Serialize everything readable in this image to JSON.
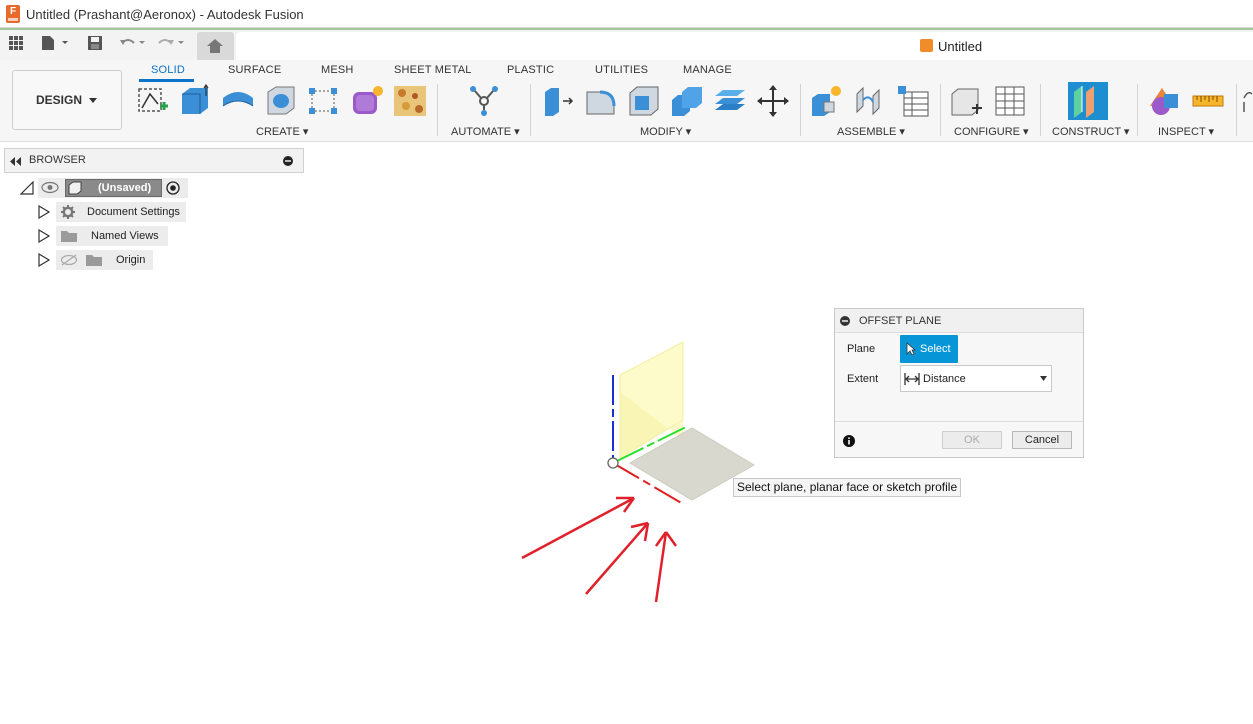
{
  "window": {
    "title": "Untitled (Prashant@Aeronox) - Autodesk Fusion",
    "app_icon": "F"
  },
  "document": {
    "tab_title": "Untitled"
  },
  "workspace": {
    "label": "DESIGN"
  },
  "tabs": [
    {
      "label": "SOLID",
      "active": true
    },
    {
      "label": "SURFACE"
    },
    {
      "label": "MESH"
    },
    {
      "label": "SHEET METAL"
    },
    {
      "label": "PLASTIC"
    },
    {
      "label": "UTILITIES"
    },
    {
      "label": "MANAGE"
    }
  ],
  "groups": {
    "create": "CREATE",
    "automate": "AUTOMATE",
    "modify": "MODIFY",
    "assemble": "ASSEMBLE",
    "configure": "CONFIGURE",
    "construct": "CONSTRUCT",
    "inspect": "INSPECT"
  },
  "browser": {
    "title": "BROWSER",
    "root": "(Unsaved)",
    "items": [
      {
        "label": "Document Settings",
        "icon": "gear-icon"
      },
      {
        "label": "Named Views",
        "icon": "folder-icon"
      },
      {
        "label": "Origin",
        "icon": "folder-icon"
      }
    ]
  },
  "dialog": {
    "title": "OFFSET PLANE",
    "plane_label": "Plane",
    "select_label": "Select",
    "extent_label": "Extent",
    "extent_value": "Distance",
    "ok_label": "OK",
    "cancel_label": "Cancel"
  },
  "tooltip": "Select plane, planar face or sketch profile",
  "colors": {
    "accent": "#0b73c9",
    "select_button": "#0696d7",
    "app_icon": "#e8692a",
    "annotation_arrows": "#e0202a"
  }
}
